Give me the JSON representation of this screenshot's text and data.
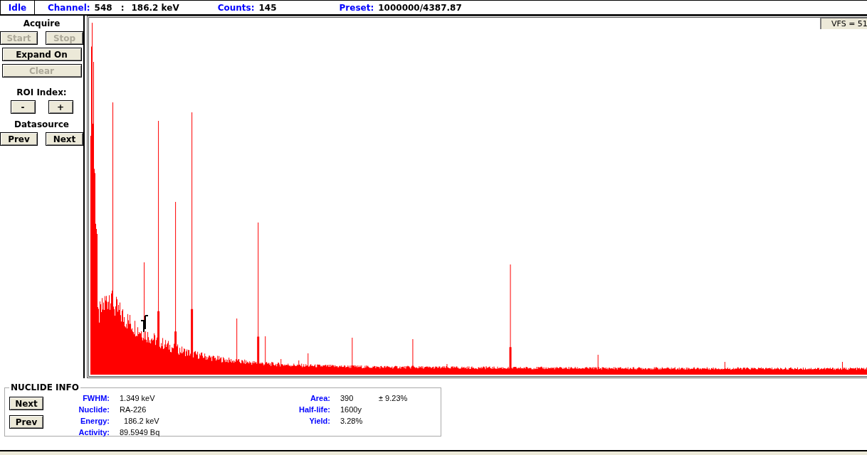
{
  "status_bar": {
    "state": "Idle",
    "channel_label": "Channel:",
    "channel": "548",
    "separator": ":",
    "energy": "186.2 keV",
    "counts_label": "Counts:",
    "counts": "145",
    "preset_label": "Preset:",
    "preset": "1000000/4387.87"
  },
  "acquire": {
    "title": "Acquire",
    "buttons": [
      {
        "label": "Start",
        "disabled": true
      },
      {
        "label": "Stop",
        "disabled": true
      }
    ],
    "expand": {
      "label": "Expand On",
      "disabled": false
    },
    "clear": {
      "label": "Clear",
      "disabled": true
    }
  },
  "roi": {
    "title": "ROI Index:",
    "buttons": [
      {
        "label": "-",
        "disabled": false
      },
      {
        "label": "+",
        "disabled": false
      }
    ]
  },
  "datasource": {
    "title": "Datasource",
    "buttons": [
      {
        "label": "Prev",
        "disabled": false
      },
      {
        "label": "Next",
        "disabled": false
      }
    ]
  },
  "plot": {
    "vfs": "VFS = 51"
  },
  "nuclide_info": {
    "title": "NUCLIDE INFO",
    "buttons": [
      {
        "label": "Next"
      },
      {
        "label": "Prev"
      }
    ],
    "left": [
      {
        "label": "FWHM:",
        "value": "1.349 keV"
      },
      {
        "label": "Nuclide:",
        "value": "RA-226"
      },
      {
        "label": "Energy:",
        "value": "  186.2 keV"
      },
      {
        "label": "Activity:",
        "value": "89.5949 Bq"
      }
    ],
    "right": [
      {
        "label": "Area:",
        "value": "390",
        "extra": "± 9.23%"
      },
      {
        "label": "Half-life:",
        "value": "1600y"
      },
      {
        "label": "Yield:",
        "value": "3.28%"
      }
    ]
  }
}
